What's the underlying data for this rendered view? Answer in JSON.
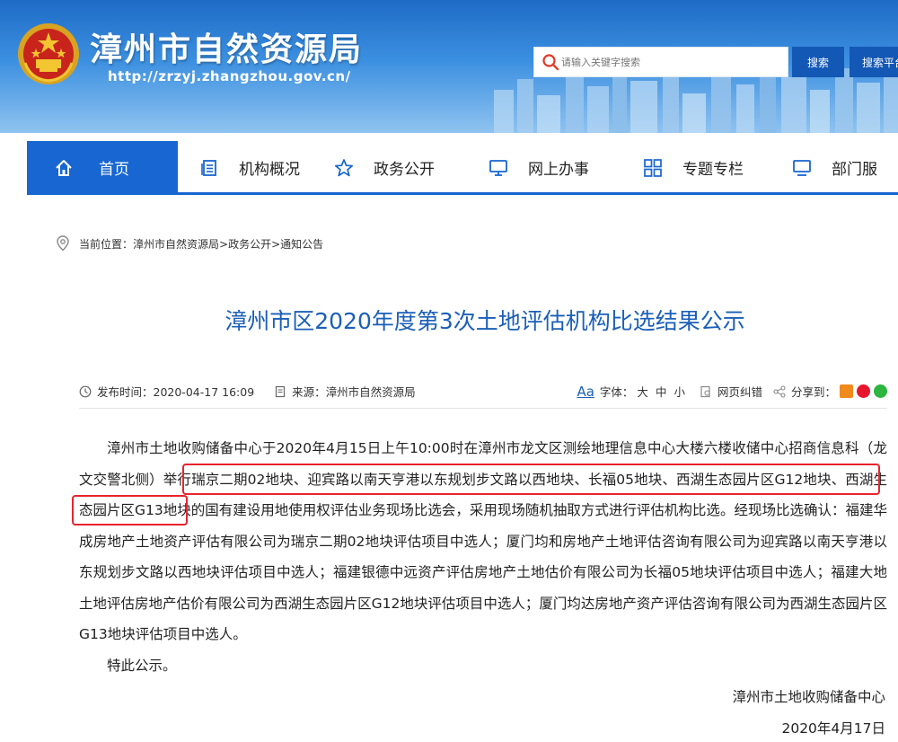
{
  "header": {
    "site_title": "漳州市自然资源局",
    "site_url": "http://zrzyj.zhangzhou.gov.cn/",
    "search_placeholder": "请输入关键字搜索",
    "search_button": "搜索",
    "platform_button": "搜索平台",
    "icons": [
      "national-emblem-icon",
      "search-icon"
    ]
  },
  "nav": {
    "items": [
      {
        "label": "首页",
        "icon": "home-icon",
        "active": true
      },
      {
        "label": "机构概况",
        "icon": "document-list-icon"
      },
      {
        "label": "政务公开",
        "icon": "star-icon"
      },
      {
        "label": "网上办事",
        "icon": "monitor-icon"
      },
      {
        "label": "专题专栏",
        "icon": "grid-icon"
      },
      {
        "label": "部门服",
        "icon": "screen-icon"
      }
    ]
  },
  "breadcrumb": {
    "prefix": "当前位置：",
    "path": "漳州市自然资源局>政务公开>通知公告"
  },
  "article": {
    "title": "漳州市区2020年度第3次土地评估机构比选结果公示",
    "meta": {
      "publish_time": "发布时间：2020-04-17 16:09",
      "source": "来源：漳州市自然资源局",
      "font_label": "字体：",
      "font_large": "大",
      "font_medium": "中",
      "font_small": "小",
      "aa": "Aa",
      "error_report": "网页纠错",
      "share_label": "分享到："
    },
    "paragraph1": "漳州市土地收购储备中心于2020年4月15日上午10:00时在漳州市龙文区测绘地理信息中心大楼六楼收储中心招商信息科（龙文交警北侧）举行瑞京二期02地块、迎宾路以南天亨港以东规划步文路以西地块、长福05地块、西湖生态园片区G12地块、西湖生态园片区G13地块的国有建设用地使用权评估业务现场比选会，采用现场随机抽取方式进行评估机构比选。经现场比选确认：福建华成房地产土地资产评估有限公司为瑞京二期02地块评估项目中选人；厦门均和房地产土地评估咨询有限公司为迎宾路以南天亨港以东规划步文路以西地块评估项目中选人；福建银德中远资产评估房地产土地估价有限公司为长福05地块评估项目中选人；福建大地土地评估房地产估价有限公司为西湖生态园片区G12地块评估项目中选人；厦门均达房地产资产评估咨询有限公司为西湖生态园片区G13地块评估项目中选人。",
    "paragraph2": "特此公示。",
    "signature_org": "漳州市土地收购储备中心",
    "signature_date": "2020年4月17日"
  },
  "colors": {
    "primary_blue": "#1766d1",
    "title_blue": "#1b5fb8",
    "annotation_red": "#e8232d"
  }
}
